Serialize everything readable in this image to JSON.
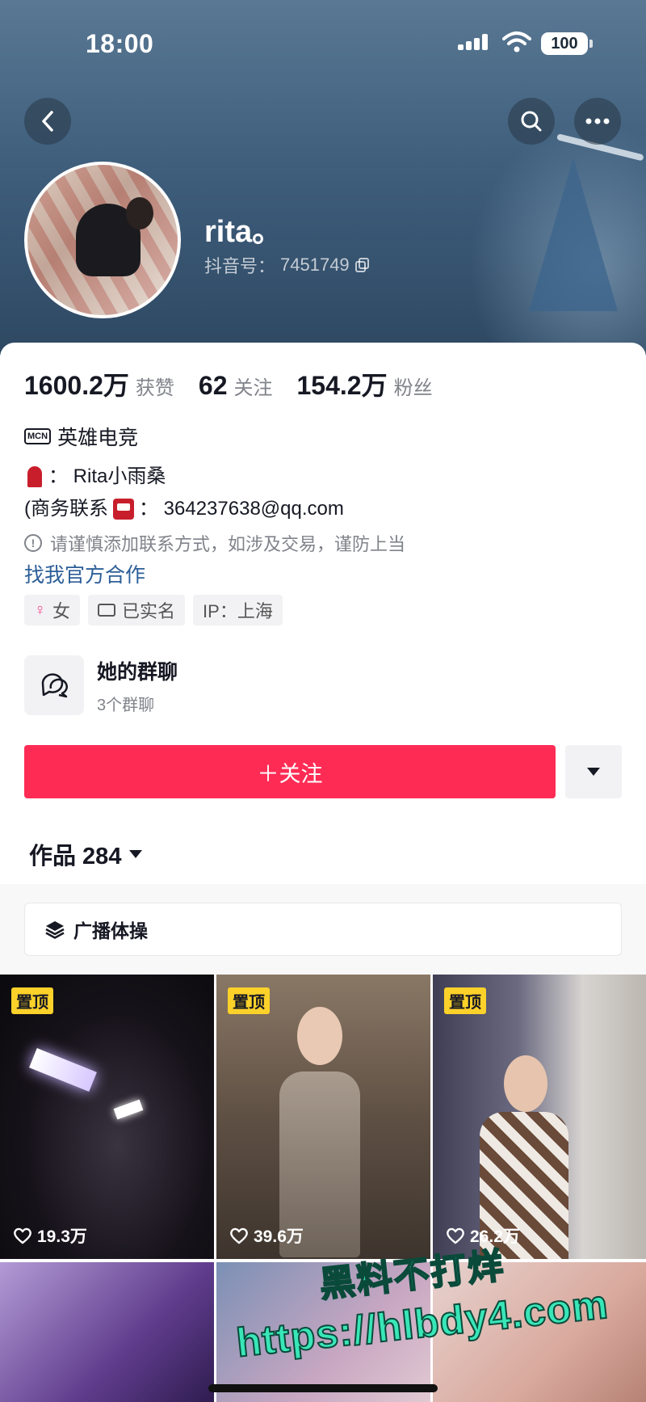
{
  "status_bar": {
    "time": "18:00",
    "battery": "100"
  },
  "profile": {
    "username": "rita。",
    "douyin_id_label": "抖音号：",
    "douyin_id": "7451749"
  },
  "stats": [
    {
      "num": "1600.2万",
      "label": "获赞"
    },
    {
      "num": "62",
      "label": "关注"
    },
    {
      "num": "154.2万",
      "label": "粉丝"
    }
  ],
  "mcn": {
    "badge": "MCN",
    "text": "英雄电竞"
  },
  "bio": {
    "line1": "：  Rita小雨桑",
    "line2_prefix": "(商务联系",
    "line2_suffix": "：  364237638@qq.com"
  },
  "warning": {
    "icon": "!",
    "text": "请谨慎添加联系方式，如涉及交易，谨防上当"
  },
  "cooperation_link": "找我官方合作",
  "tags": {
    "gender": "女",
    "verified": "已实名",
    "ip": "IP：上海"
  },
  "group_chat": {
    "title": "她的群聊",
    "subtitle": "3个群聊"
  },
  "follow_button": "＋关注",
  "works": {
    "label": "作品 284"
  },
  "playlist": {
    "label": "广播体操"
  },
  "videos": [
    {
      "pinned": "置顶",
      "likes": "19.3万"
    },
    {
      "pinned": "置顶",
      "likes": "39.6万"
    },
    {
      "pinned": "置顶",
      "likes": "26.2万"
    }
  ],
  "watermark": {
    "line1": "黑料不打烊",
    "line2": "https://hlbdy4.com"
  },
  "colors": {
    "accent": "#fe2c55",
    "pin": "#fcd12a",
    "link": "#2c5e98"
  }
}
